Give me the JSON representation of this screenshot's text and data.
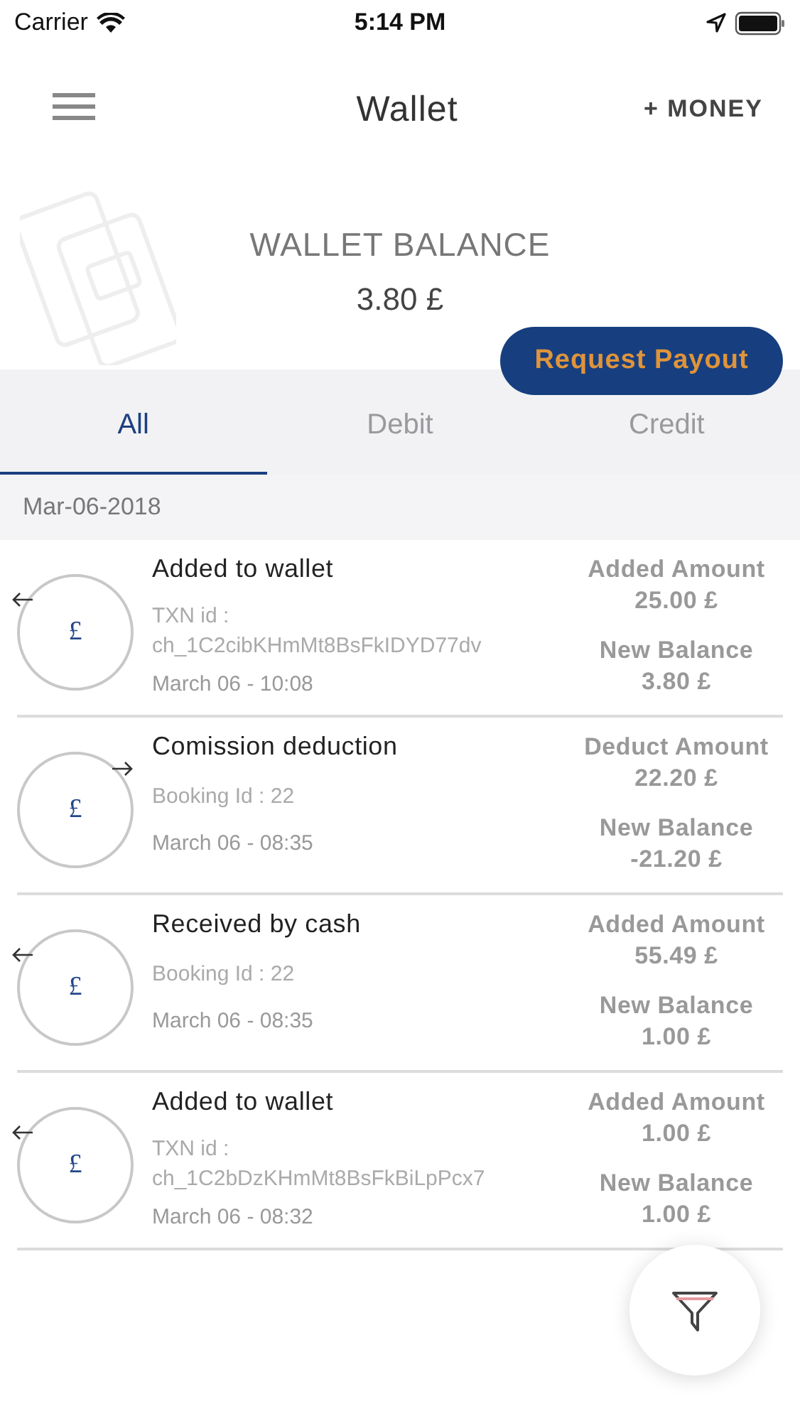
{
  "status_bar": {
    "carrier": "Carrier",
    "time": "5:14 PM"
  },
  "header": {
    "title": "Wallet",
    "action": "+ MONEY"
  },
  "balance": {
    "label": "WALLET BALANCE",
    "amount": "3.80 £",
    "payout_button": "Request Payout"
  },
  "tabs": [
    {
      "label": "All",
      "selected": true
    },
    {
      "label": "Debit",
      "selected": false
    },
    {
      "label": "Credit",
      "selected": false
    }
  ],
  "date_header": "Mar-06-2018",
  "transactions": [
    {
      "kind": "credit",
      "symbol": "£",
      "title": "Added to wallet",
      "reference_lines": [
        "TXN id :",
        "ch_1C2cibKHmMt8BsFkIDYD77dv"
      ],
      "time": "March 06 - 10:08",
      "amount_label": "Added Amount",
      "amount": "25.00 £",
      "balance_label": "New Balance",
      "balance": "3.80 £"
    },
    {
      "kind": "debit",
      "symbol": "£",
      "title": "Comission deduction",
      "reference_lines": [
        "Booking Id : 22"
      ],
      "time": "March 06 - 08:35",
      "amount_label": "Deduct Amount",
      "amount": "22.20 £",
      "balance_label": "New Balance",
      "balance": "-21.20 £"
    },
    {
      "kind": "credit",
      "symbol": "£",
      "title": "Received by cash",
      "reference_lines": [
        "Booking Id : 22"
      ],
      "time": "March 06 - 08:35",
      "amount_label": "Added Amount",
      "amount": "55.49 £",
      "balance_label": "New Balance",
      "balance": "1.00 £"
    },
    {
      "kind": "credit",
      "symbol": "£",
      "title": "Added to wallet",
      "reference_lines": [
        "TXN id :",
        "ch_1C2bDzKHmMt8BsFkBiLpPcx7"
      ],
      "time": "March 06 - 08:32",
      "amount_label": "Added Amount",
      "amount": "1.00 £",
      "balance_label": "New Balance",
      "balance": "1.00 £"
    }
  ]
}
